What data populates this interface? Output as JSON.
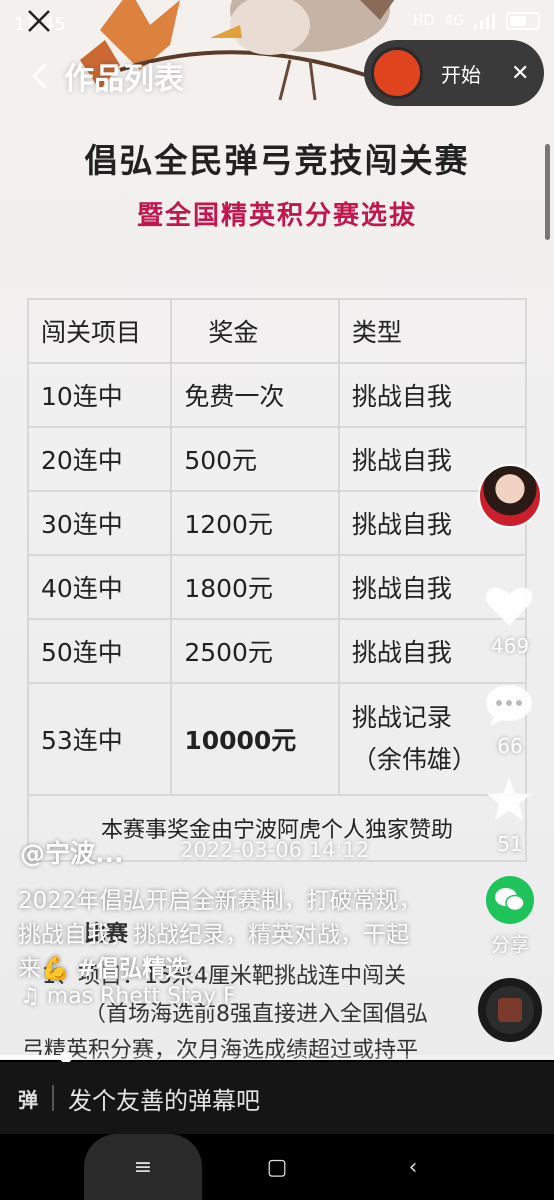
{
  "status_bar": {
    "time": "11:45",
    "network": "4G",
    "hd": "HD"
  },
  "top_bar": {
    "title": "作品列表"
  },
  "record": {
    "start_label": "开始"
  },
  "video": {
    "title_main": "倡弘全民弹弓竞技闯关赛",
    "title_sub": "暨全国精英积分赛选拔",
    "table": {
      "headers": [
        "闯关项目",
        "奖金",
        "类型"
      ],
      "rows": [
        [
          "10连中",
          "免费一次",
          "挑战自我"
        ],
        [
          "20连中",
          "500元",
          "挑战自我"
        ],
        [
          "30连中",
          "1200元",
          "挑战自我"
        ],
        [
          "40连中",
          "1800元",
          "挑战自我"
        ],
        [
          "50连中",
          "2500元",
          "挑战自我"
        ],
        [
          "53连中",
          "10000元",
          "挑战记录",
          "（余伟雄）"
        ]
      ],
      "sponsor": "本赛事奖金由宁波阿虎个人独家赞助"
    },
    "bg_heading": "比赛",
    "bg_line1": "1、项目：15米4厘米靶挑战连中闯关",
    "bg_line2": "（首场海选前8强直接进入全国倡弘",
    "bg_line3": "弓精英积分赛，次月海选成绩超过或持平"
  },
  "rail": {
    "likes": "469",
    "comments": "66",
    "favorites": "51",
    "share_label": "分享"
  },
  "post": {
    "author": "@宁波...",
    "time": "2022-03-06 14:12",
    "caption_text": "2022年倡弘开启全新赛制，打破常规，挑战自我，挑战纪录，精英对战，干起来💪 ",
    "caption_tag": "#倡弘精选",
    "music": "♫ mas Rhett   Stay F"
  },
  "progress": {
    "fraction": 0.12
  },
  "danmaku": {
    "icon_label": "弹",
    "placeholder": "发个友善的弹幕吧"
  },
  "nav": {
    "menu": "≡",
    "home": "▢",
    "back": "‹"
  }
}
